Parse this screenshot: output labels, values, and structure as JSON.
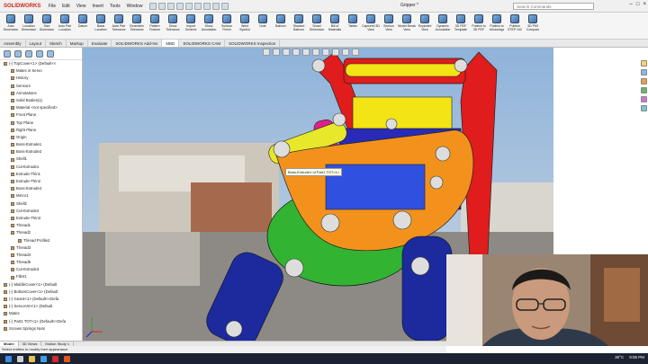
{
  "app": {
    "logo": "SOLIDWORKS",
    "menu": [
      "File",
      "Edit",
      "View",
      "Insert",
      "Tools",
      "Window"
    ],
    "document_title": "Gripper *",
    "search_placeholder": "Search Commands"
  },
  "window_controls": [
    "–",
    "□",
    "×"
  ],
  "command_manager": [
    {
      "label": "Auto Dimension Scheme",
      "icon": "auto-dimension-icon"
    },
    {
      "label": "Location Dimension",
      "icon": "location-dimension-icon"
    },
    {
      "label": "Size Dimension",
      "icon": "size-dimension-icon"
    },
    {
      "label": "Auto Pair Location Dimension",
      "icon": "pair-dimension-icon"
    },
    {
      "label": "Datum",
      "icon": "datum-icon"
    },
    {
      "label": "Basic Location Dimension",
      "icon": "basic-location-icon"
    },
    {
      "label": "Auto Pair Tolerance",
      "icon": "auto-pair-tolerance-icon"
    },
    {
      "label": "Geometric Tolerance",
      "icon": "geometric-tolerance-icon"
    },
    {
      "label": "Pattern Feature",
      "icon": "pattern-feature-icon"
    },
    {
      "label": "Show Tolerance Status",
      "icon": "tolerance-status-icon"
    },
    {
      "label": "Import Scheme",
      "icon": "import-scheme-icon"
    },
    {
      "label": "Show Annotation Features",
      "icon": "annotation-features-icon"
    },
    {
      "label": "Surface Finish",
      "icon": "surface-finish-icon"
    },
    {
      "label": "Weld Symbol",
      "icon": "weld-symbol-icon"
    },
    {
      "label": "Note",
      "icon": "note-icon"
    },
    {
      "label": "Balloon",
      "icon": "balloon-icon"
    },
    {
      "label": "Stacked Balloon",
      "icon": "stacked-balloon-icon"
    },
    {
      "label": "Smart Dimension",
      "icon": "smart-dimension-icon"
    },
    {
      "label": "Bill of Materials",
      "icon": "bill-of-materials-icon"
    },
    {
      "label": "Tables",
      "icon": "tables-icon"
    },
    {
      "label": "Captured 3D View",
      "icon": "captured-view-icon"
    },
    {
      "label": "Section View",
      "icon": "section-view-icon"
    },
    {
      "label": "Model Break View",
      "icon": "model-break-view-icon"
    },
    {
      "label": "Exploded View",
      "icon": "exploded-view-icon"
    },
    {
      "label": "Dynamic Annotation Views",
      "icon": "dynamic-annotation-icon"
    },
    {
      "label": "3D PDF Template Editor",
      "icon": "pdf-template-icon"
    },
    {
      "label": "Publish to 3D PDF",
      "icon": "publish-pdf-icon"
    },
    {
      "label": "Publish to eDrawings",
      "icon": "publish-edrawings-icon"
    },
    {
      "label": "Publish STEP 242 File",
      "icon": "publish-step-icon"
    },
    {
      "label": "3D PMI Compare",
      "icon": "pmi-compare-icon"
    }
  ],
  "tabs": [
    {
      "label": "Assembly",
      "active": false
    },
    {
      "label": "Layout",
      "active": false
    },
    {
      "label": "Sketch",
      "active": false
    },
    {
      "label": "Markup",
      "active": false
    },
    {
      "label": "Evaluate",
      "active": false
    },
    {
      "label": "SOLIDWORKS Add-Ins",
      "active": false
    },
    {
      "label": "MBD",
      "active": true
    },
    {
      "label": "SOLIDWORKS CAM",
      "active": false
    },
    {
      "label": "SOLIDWORKS Inspection",
      "active": false
    }
  ],
  "feature_tree": [
    {
      "label": "(-) TopCover<1> (Default<<",
      "indent": 0,
      "icon": "part-icon"
    },
    {
      "label": "Mates in Servo",
      "indent": 1,
      "icon": "mates-icon"
    },
    {
      "label": "History",
      "indent": 1,
      "icon": "history-icon"
    },
    {
      "label": "Sensors",
      "indent": 1,
      "icon": "sensor-icon"
    },
    {
      "label": "Annotations",
      "indent": 1,
      "icon": "annotations-icon"
    },
    {
      "label": "Solid Bodies(1)",
      "indent": 1,
      "icon": "solid-bodies-icon"
    },
    {
      "label": "Material <not specified>",
      "indent": 1,
      "icon": "material-icon"
    },
    {
      "label": "Front Plane",
      "indent": 1,
      "icon": "plane-icon"
    },
    {
      "label": "Top Plane",
      "indent": 1,
      "icon": "plane-icon"
    },
    {
      "label": "Right Plane",
      "indent": 1,
      "icon": "plane-icon"
    },
    {
      "label": "Origin",
      "indent": 1,
      "icon": "origin-icon"
    },
    {
      "label": "Boss-Extrude1",
      "indent": 1,
      "icon": "extrude-icon"
    },
    {
      "label": "Boss-Extrude2",
      "indent": 1,
      "icon": "extrude-icon"
    },
    {
      "label": "Shell1",
      "indent": 1,
      "icon": "shell-icon"
    },
    {
      "label": "Cut-Extrude1",
      "indent": 1,
      "icon": "cut-icon"
    },
    {
      "label": "Extrude-Thin1",
      "indent": 1,
      "icon": "extrude-icon"
    },
    {
      "label": "Extrude-Thin2",
      "indent": 1,
      "icon": "extrude-icon"
    },
    {
      "label": "Boss-Extrude4",
      "indent": 1,
      "icon": "extrude-icon"
    },
    {
      "label": "Mirror1",
      "indent": 1,
      "icon": "mirror-icon"
    },
    {
      "label": "Shell2",
      "indent": 1,
      "icon": "shell-icon"
    },
    {
      "label": "Cut-Extrude2",
      "indent": 1,
      "icon": "cut-icon"
    },
    {
      "label": "Extrude-Thin3",
      "indent": 1,
      "icon": "extrude-icon"
    },
    {
      "label": "Thread1",
      "indent": 1,
      "icon": "thread-icon"
    },
    {
      "label": "Thread2",
      "indent": 1,
      "icon": "thread-icon"
    },
    {
      "label": "Thread Profile2",
      "indent": 2,
      "icon": "sketch-icon"
    },
    {
      "label": "Thread3",
      "indent": 1,
      "icon": "thread-icon"
    },
    {
      "label": "Thread4",
      "indent": 1,
      "icon": "thread-icon"
    },
    {
      "label": "Thread5",
      "indent": 1,
      "icon": "thread-icon"
    },
    {
      "label": "Cut-Extrude3",
      "indent": 1,
      "icon": "cut-icon"
    },
    {
      "label": "Fillet1",
      "indent": 1,
      "icon": "fillet-icon"
    },
    {
      "label": "(-) MiddleCover<1> (Default",
      "indent": 0,
      "icon": "part-icon"
    },
    {
      "label": "(-) BottomCover<1> (Default",
      "indent": 0,
      "icon": "part-icon"
    },
    {
      "label": "(-) Gear4<1> (Default<<Defa",
      "indent": 0,
      "icon": "part-icon"
    },
    {
      "label": "(-) ServoArm<1> (Default",
      "indent": 0,
      "icon": "part-icon"
    },
    {
      "label": "Mates",
      "indent": 0,
      "icon": "mates-icon"
    },
    {
      "label": "(-) Part1 TOT<1> (Default<<Defa",
      "indent": 0,
      "icon": "part-icon"
    },
    {
      "label": "Screws Springs Nuts",
      "indent": 0,
      "icon": "folder-icon"
    }
  ],
  "tooltip": "Boss-Extrude1 of Part1 TOT<1>",
  "bottom_tabs": [
    {
      "label": "Model",
      "active": true
    },
    {
      "label": "3D Views",
      "active": false
    },
    {
      "label": "Motion Study 1",
      "active": false
    }
  ],
  "status_text": "Select entities to modify their appearance",
  "taskbar": {
    "temperature": "30°C",
    "time": "9:05 PM"
  }
}
